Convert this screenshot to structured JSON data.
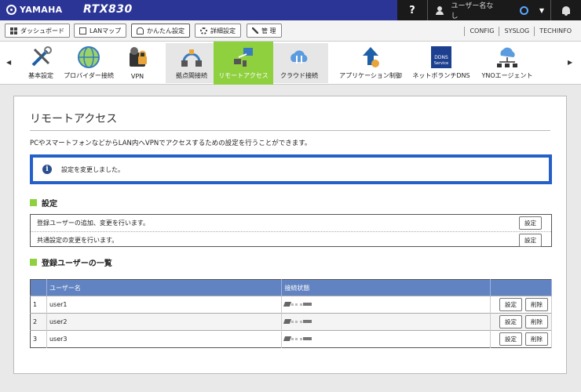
{
  "header": {
    "brand": "YAMAHA",
    "model": "RTX830",
    "help": "?",
    "user": "ユーザー名なし"
  },
  "toolbar": {
    "buttons": [
      "ダッシュボード",
      "LANマップ",
      "かんたん設定",
      "詳細設定",
      "管 理"
    ],
    "links": [
      "CONFIG",
      "SYSLOG",
      "TECHINFO"
    ]
  },
  "menu": {
    "items": [
      "基本設定",
      "プロバイダー接続",
      "VPN",
      "拠点間接続",
      "リモートアクセス",
      "クラウド接続",
      "アプリケーション制御",
      "ネットボランチDNS",
      "YNOエージェント"
    ],
    "ddns_lines": [
      "DDNS",
      "Service"
    ]
  },
  "page": {
    "title": "リモートアクセス",
    "description": "PCやスマートフォンなどからLAN内へVPNでアクセスするための設定を行うことができます。",
    "notice": "設定を変更しました。"
  },
  "settings": {
    "heading": "設定",
    "rows": [
      {
        "text": "登録ユーザーの追加、変更を行います。",
        "button": "設定"
      },
      {
        "text": "共通設定の変更を行います。",
        "button": "設定"
      }
    ]
  },
  "users": {
    "heading": "登録ユーザーの一覧",
    "columns": [
      "ユーザー名",
      "接続状態"
    ],
    "rows": [
      {
        "no": "1",
        "name": "user1"
      },
      {
        "no": "2",
        "name": "user2"
      },
      {
        "no": "3",
        "name": "user3"
      }
    ],
    "edit_label": "設定",
    "delete_label": "削除"
  },
  "colors": {
    "header_bg": "#2b3596",
    "accent_green": "#8fd03f",
    "notice_border": "#2560c8",
    "table_header": "#6283c2"
  }
}
